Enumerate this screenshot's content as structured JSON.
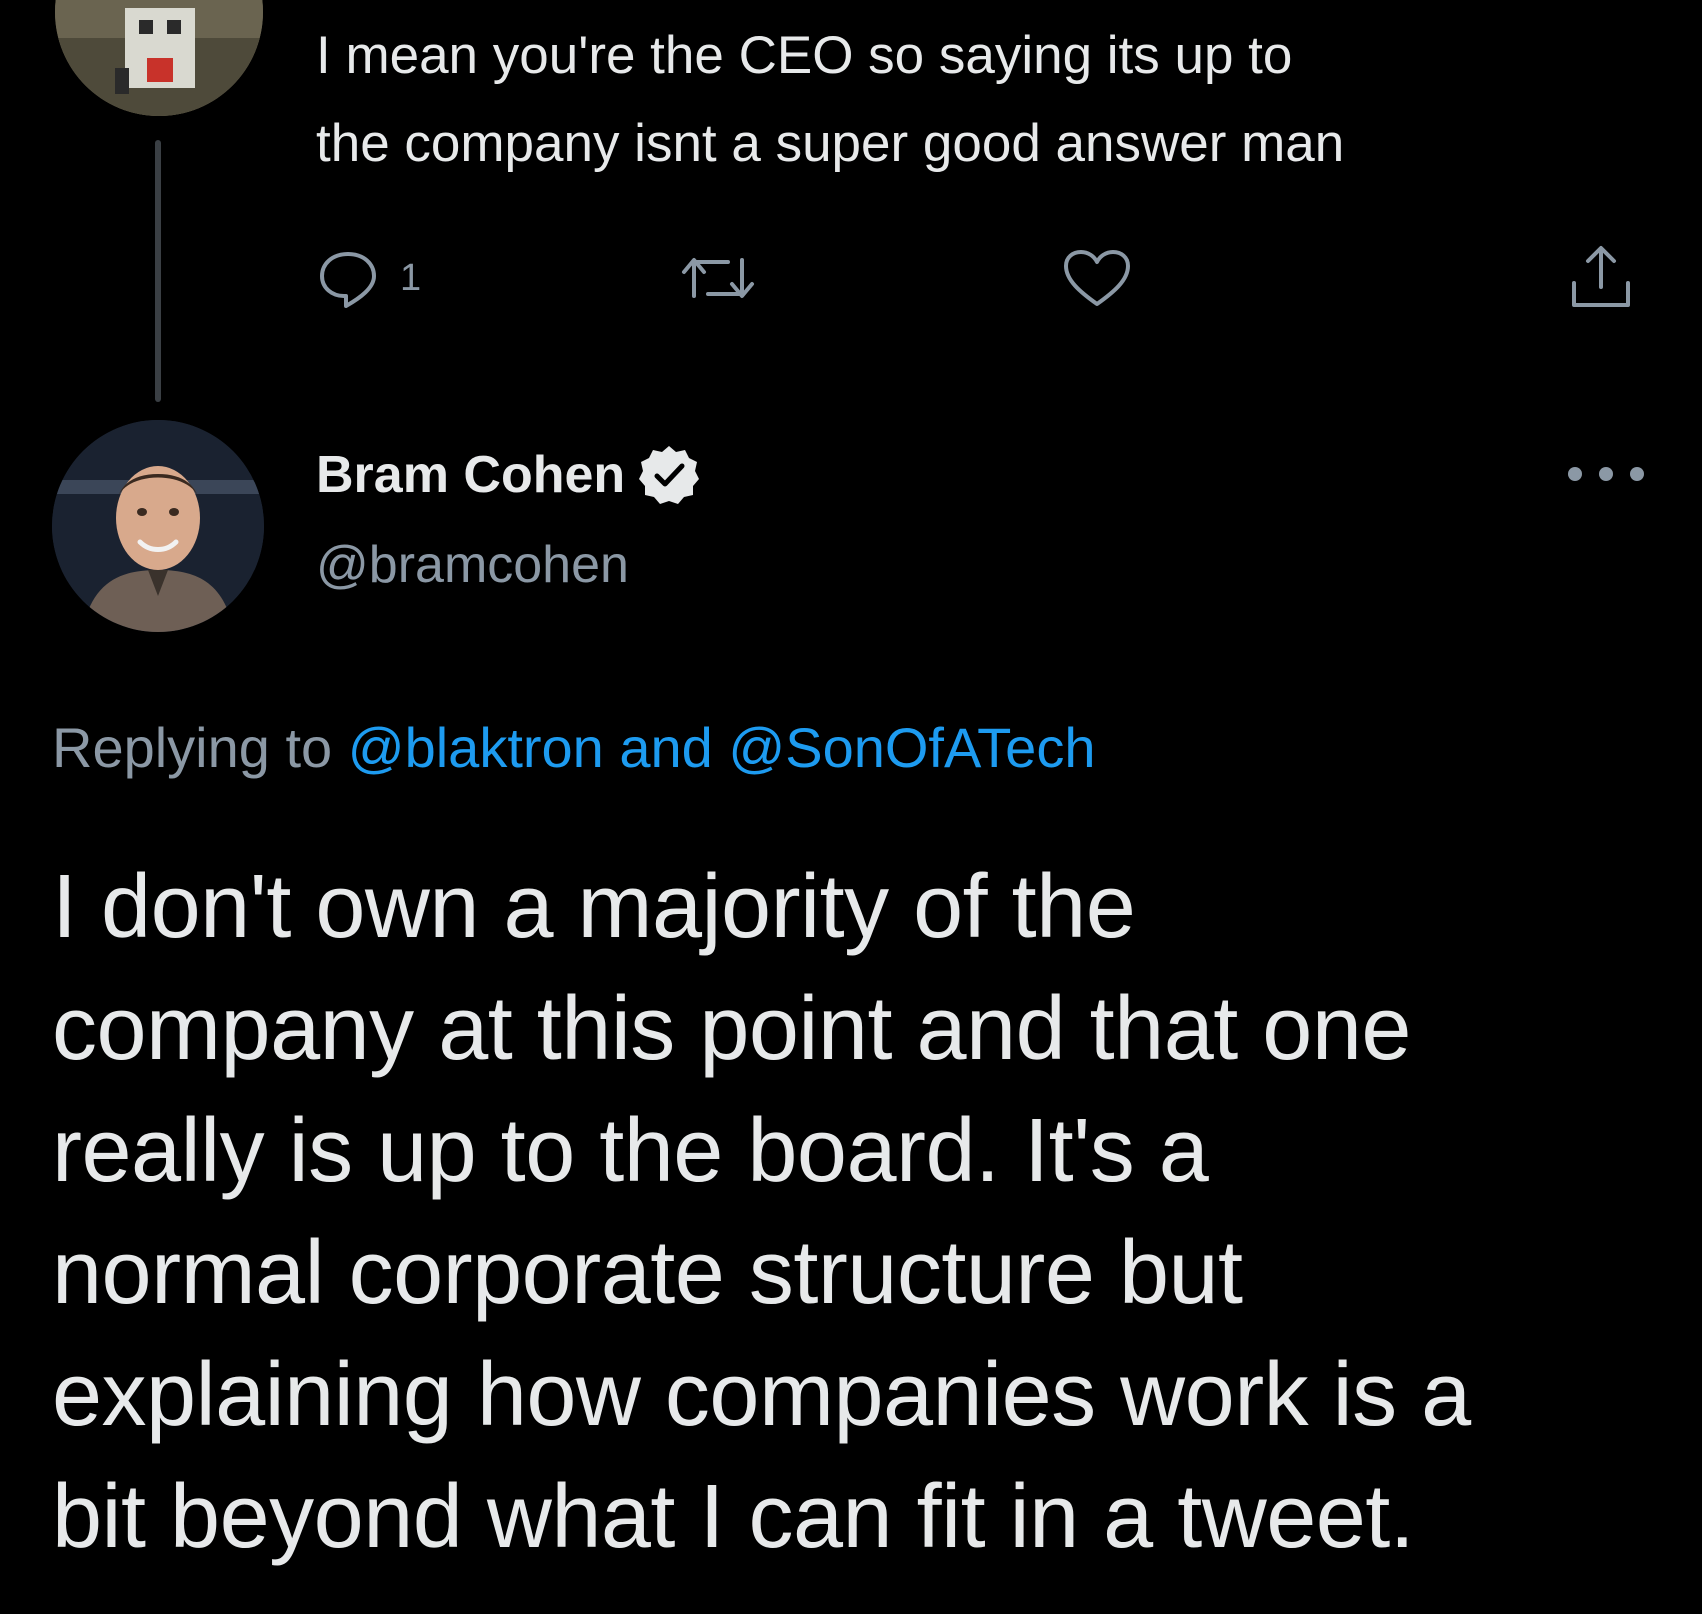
{
  "colors": {
    "background": "#000000",
    "text_primary": "#e7e9ea",
    "text_secondary": "#8b98a5",
    "link": "#1d9bf0",
    "thread_line": "#3a3f44"
  },
  "previous_tweet": {
    "avatar_icon": "user-avatar-icon",
    "text_lines": [
      "I mean you're the CEO so saying its up to",
      "the company isnt a super good answer man"
    ],
    "actions": {
      "reply_icon": "reply-icon",
      "reply_count": "1",
      "retweet_icon": "retweet-icon",
      "like_icon": "heart-icon",
      "share_icon": "share-icon"
    }
  },
  "tweet": {
    "author": {
      "display_name": "Bram Cohen",
      "handle": "@bramcohen",
      "verified_icon": "verified-badge-icon",
      "more_icon": "more-options-icon"
    },
    "replying": {
      "prefix": "Replying to ",
      "mention_1": "@blaktron",
      "joiner": " and ",
      "mention_2": "@SonOfATech"
    },
    "body_lines": [
      "I don't own a majority of the",
      "company at this point and that one",
      "really is up to the board. It's a",
      "normal corporate structure but",
      "explaining how companies work is a",
      "bit beyond what I can fit in a tweet."
    ]
  }
}
